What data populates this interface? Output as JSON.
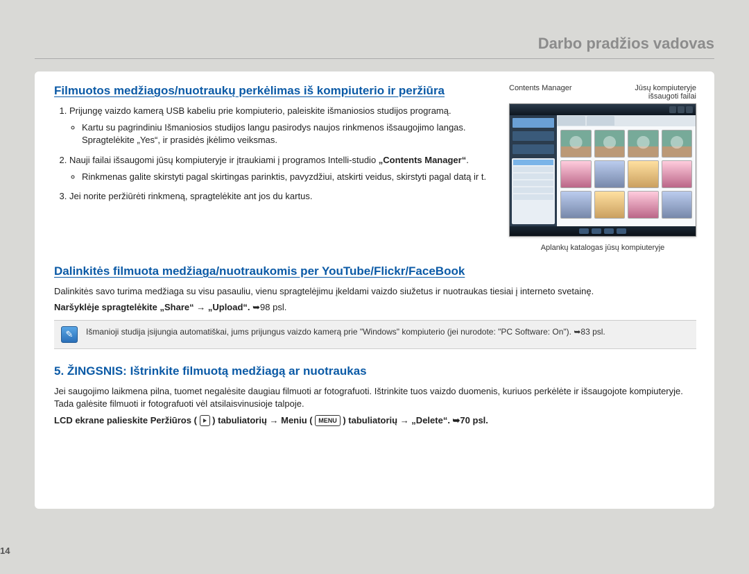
{
  "header": {
    "title": "Darbo pradžios vadovas"
  },
  "section1": {
    "title": "Filmuotos medžiagos/nuotraukų perkėlimas iš kompiuterio ir peržiūra",
    "items": {
      "i1": "Prijungę vaizdo kamerą USB kabeliu prie kompiuterio, paleiskite išmaniosios studijos programą.",
      "i1b": "Kartu su pagrindiniu Išmaniosios studijos langu pasirodys naujos rinkmenos išsaugojimo langas. Spragtelėkite „Yes“, ir prasidės įkėlimo veiksmas.",
      "i2a": "Nauji failai išsaugomi jūsų kompiuteryje ir įtraukiami į programos Intelli-studio ",
      "i2b": "„Contents Manager“",
      "i2c": ".",
      "i2bul": "Rinkmenas galite skirstyti pagal skirtingas parinktis, pavyzdžiui, atskirti veidus, skirstyti pagal datą ir t.",
      "i3": "Jei norite peržiūrėti rinkmeną, spragtelėkite ant jos du kartus."
    },
    "figure": {
      "left_label": "Contents Manager",
      "right_label_line1": "Jūsų kompiuteryje",
      "right_label_line2": "išsaugoti failai",
      "bottom_caption": "Aplankų katalogas jūsų kompiuteryje"
    }
  },
  "section2": {
    "title": "Dalinkitės filmuota medžiaga/nuotraukomis per YouTube/Flickr/FaceBook",
    "para": "Dalinkitės savo turima medžiaga su visu pasauliu, vienu spragtelėjimu įkeldami vaizdo siužetus ir nuotraukas tiesiai į interneto svetainę.",
    "instr_prefix": "Naršyklėje spragtelėkite „Share“ ",
    "instr_arrow": "→",
    "instr_mid": " „Upload“. ",
    "instr_pageref": "➥98 psl.",
    "note": "Išmanioji studija įsijungia automatiškai, jums prijungus vaizdo kamerą prie \"Windows\" kompiuterio (jei nurodote: \"PC Software: On\"). ➥83 psl."
  },
  "section3": {
    "title": "5. ŽINGSNIS: Ištrinkite filmuotą medžiagą ar nuotraukas",
    "para": "Jei saugojimo laikmena pilna, tuomet negalėsite daugiau filmuoti ar fotografuoti. Ištrinkite tuos vaizdo duomenis, kuriuos perkėlėte ir išsaugojote kompiuteryje. Tada galėsite filmuoti ir fotografuoti vėl atsilaisvinusioje talpoje.",
    "instr_prefix": "LCD ekrane palieskite Peržiūros (",
    "instr_after_play": ") tabuliatorių → Meniu (",
    "menu_label": "MENU",
    "instr_after_menu": ") tabuliatorių → „Delete“. ➥70 psl."
  },
  "page_number": "14"
}
